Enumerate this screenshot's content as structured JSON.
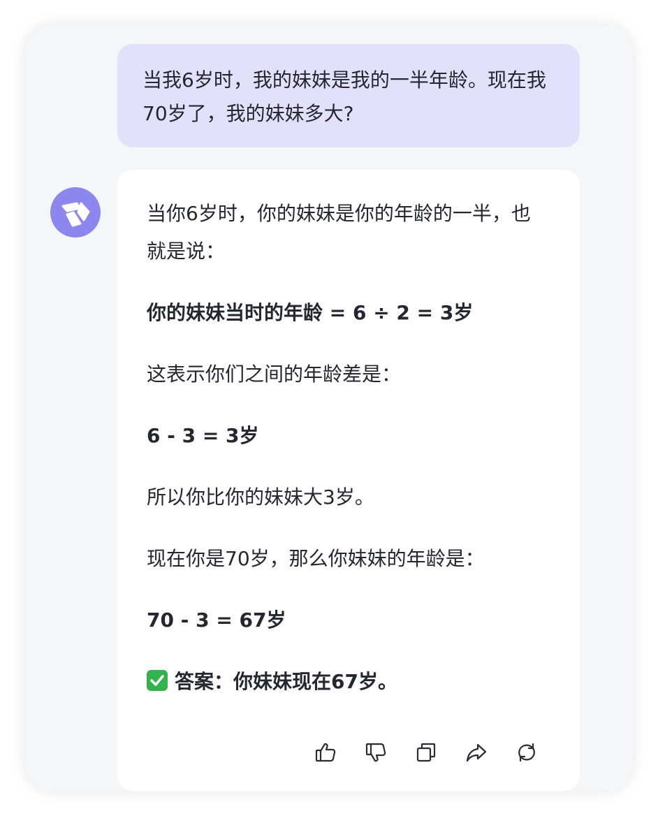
{
  "user_message": {
    "text": "当我6岁时，我的妹妹是我的一半年龄。现在我70岁了，我的妹妹多大?"
  },
  "assistant": {
    "avatar_icon": "assistant-logo-icon",
    "avatar_color": "#8d86ef",
    "paragraphs": [
      "当你6岁时，你的妹妹是你的年龄的一半，也就是说：",
      "你的妹妹当时的年龄 = 6 ÷ 2 = 3岁",
      "这表示你们之间的年龄差是：",
      "6 - 3 = 3岁",
      "所以你比你的妹妹大3岁。",
      "现在你是70岁，那么你妹妹的年龄是：",
      "70 - 3 = 67岁",
      "答案：你妹妹现在67岁。"
    ],
    "answer_icon": "check-mark-icon"
  },
  "actions": [
    {
      "icon": "thumbs-up-icon"
    },
    {
      "icon": "thumbs-down-icon"
    },
    {
      "icon": "copy-icon"
    },
    {
      "icon": "share-icon"
    },
    {
      "icon": "regenerate-icon"
    }
  ],
  "colors": {
    "user_bubble": "#e1e1fb",
    "frame_background": "#f5f6fa",
    "answer_background": "#ffffff",
    "text": "#262630",
    "check": "#34b24c"
  }
}
